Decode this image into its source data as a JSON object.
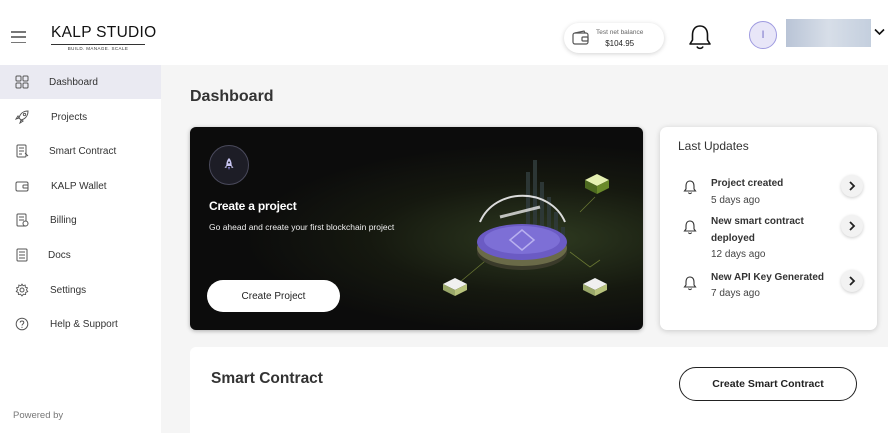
{
  "header": {
    "logo_main": "KALP STUDIO",
    "logo_tagline": "BUILD. MANAGE. SCALE",
    "balance_label": "Test net balance",
    "balance_value": "$104.95",
    "avatar_initial": "I"
  },
  "sidebar": {
    "items": [
      {
        "label": "Dashboard",
        "icon": "dashboard-icon",
        "active": true
      },
      {
        "label": "Projects",
        "icon": "rocket-icon"
      },
      {
        "label": "Smart Contract",
        "icon": "document-icon"
      },
      {
        "label": "KALP Wallet",
        "icon": "wallet-icon"
      },
      {
        "label": "Billing",
        "icon": "invoice-icon"
      },
      {
        "label": "Docs",
        "icon": "docs-icon"
      },
      {
        "label": "Settings",
        "icon": "gear-icon"
      },
      {
        "label": "Help & Support",
        "icon": "help-icon"
      }
    ],
    "powered_by": "Powered by"
  },
  "main": {
    "page_title": "Dashboard",
    "hero": {
      "title": "Create a project",
      "description": "Go ahead and create your first blockchain project",
      "button_label": "Create Project"
    },
    "updates": {
      "title": "Last Updates",
      "items": [
        {
          "title": "Project created",
          "time": "5 days ago"
        },
        {
          "title": "New smart contract deployed",
          "time": "12 days ago"
        },
        {
          "title": "New API Key Generated",
          "time": "7 days ago"
        }
      ]
    },
    "smart_contract": {
      "title": "Smart Contract",
      "button_label": "Create Smart Contract"
    }
  },
  "colors": {
    "accent": "#9f9be0",
    "sidebar_active_bg": "#eaeaf2",
    "hero_bg": "#0c0c0c",
    "hero_platform": "#6b5bc4"
  }
}
